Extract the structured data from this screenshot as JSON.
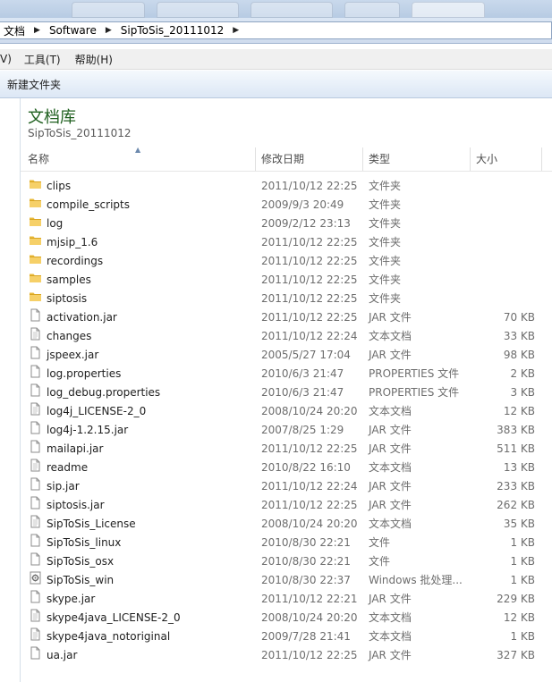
{
  "breadcrumb": [
    "文档",
    "Software",
    "SipToSis_20111012"
  ],
  "menu": [
    "V)",
    "工具(T)",
    "帮助(H)"
  ],
  "toolbar": {
    "new_folder": "新建文件夹"
  },
  "library": {
    "title": "文档库",
    "subtitle": "SipToSis_20111012"
  },
  "columns": {
    "name": "名称",
    "date": "修改日期",
    "type": "类型",
    "size": "大小"
  },
  "files": [
    {
      "name": "clips",
      "date": "2011/10/12 22:25",
      "type": "文件夹",
      "size": "",
      "icon": "folder-icon"
    },
    {
      "name": "compile_scripts",
      "date": "2009/9/3 20:49",
      "type": "文件夹",
      "size": "",
      "icon": "folder-icon"
    },
    {
      "name": "log",
      "date": "2009/2/12 23:13",
      "type": "文件夹",
      "size": "",
      "icon": "folder-icon"
    },
    {
      "name": "mjsip_1.6",
      "date": "2011/10/12 22:25",
      "type": "文件夹",
      "size": "",
      "icon": "folder-icon"
    },
    {
      "name": "recordings",
      "date": "2011/10/12 22:25",
      "type": "文件夹",
      "size": "",
      "icon": "folder-icon"
    },
    {
      "name": "samples",
      "date": "2011/10/12 22:25",
      "type": "文件夹",
      "size": "",
      "icon": "folder-icon"
    },
    {
      "name": "siptosis",
      "date": "2011/10/12 22:25",
      "type": "文件夹",
      "size": "",
      "icon": "folder-icon"
    },
    {
      "name": "activation.jar",
      "date": "2011/10/12 22:25",
      "type": "JAR 文件",
      "size": "70 KB",
      "icon": "file-icon"
    },
    {
      "name": "changes",
      "date": "2011/10/12 22:24",
      "type": "文本文档",
      "size": "33 KB",
      "icon": "text-file-icon"
    },
    {
      "name": "jspeex.jar",
      "date": "2005/5/27 17:04",
      "type": "JAR 文件",
      "size": "98 KB",
      "icon": "file-icon"
    },
    {
      "name": "log.properties",
      "date": "2010/6/3 21:47",
      "type": "PROPERTIES 文件",
      "size": "2 KB",
      "icon": "file-icon"
    },
    {
      "name": "log_debug.properties",
      "date": "2010/6/3 21:47",
      "type": "PROPERTIES 文件",
      "size": "3 KB",
      "icon": "file-icon"
    },
    {
      "name": "log4j_LICENSE-2_0",
      "date": "2008/10/24 20:20",
      "type": "文本文档",
      "size": "12 KB",
      "icon": "text-file-icon"
    },
    {
      "name": "log4j-1.2.15.jar",
      "date": "2007/8/25 1:29",
      "type": "JAR 文件",
      "size": "383 KB",
      "icon": "file-icon"
    },
    {
      "name": "mailapi.jar",
      "date": "2011/10/12 22:25",
      "type": "JAR 文件",
      "size": "511 KB",
      "icon": "file-icon"
    },
    {
      "name": "readme",
      "date": "2010/8/22 16:10",
      "type": "文本文档",
      "size": "13 KB",
      "icon": "text-file-icon"
    },
    {
      "name": "sip.jar",
      "date": "2011/10/12 22:24",
      "type": "JAR 文件",
      "size": "233 KB",
      "icon": "file-icon"
    },
    {
      "name": "siptosis.jar",
      "date": "2011/10/12 22:25",
      "type": "JAR 文件",
      "size": "262 KB",
      "icon": "file-icon"
    },
    {
      "name": "SipToSis_License",
      "date": "2008/10/24 20:20",
      "type": "文本文档",
      "size": "35 KB",
      "icon": "text-file-icon"
    },
    {
      "name": "SipToSis_linux",
      "date": "2010/8/30 22:21",
      "type": "文件",
      "size": "1 KB",
      "icon": "file-icon"
    },
    {
      "name": "SipToSis_osx",
      "date": "2010/8/30 22:21",
      "type": "文件",
      "size": "1 KB",
      "icon": "file-icon"
    },
    {
      "name": "SipToSis_win",
      "date": "2010/8/30 22:37",
      "type": "Windows 批处理...",
      "size": "1 KB",
      "icon": "batch-file-icon"
    },
    {
      "name": "skype.jar",
      "date": "2011/10/12 22:21",
      "type": "JAR 文件",
      "size": "229 KB",
      "icon": "file-icon"
    },
    {
      "name": "skype4java_LICENSE-2_0",
      "date": "2008/10/24 20:20",
      "type": "文本文档",
      "size": "12 KB",
      "icon": "text-file-icon"
    },
    {
      "name": "skype4java_notoriginal",
      "date": "2009/7/28 21:41",
      "type": "文本文档",
      "size": "1 KB",
      "icon": "text-file-icon"
    },
    {
      "name": "ua.jar",
      "date": "2011/10/12 22:25",
      "type": "JAR 文件",
      "size": "327 KB",
      "icon": "file-icon"
    }
  ]
}
